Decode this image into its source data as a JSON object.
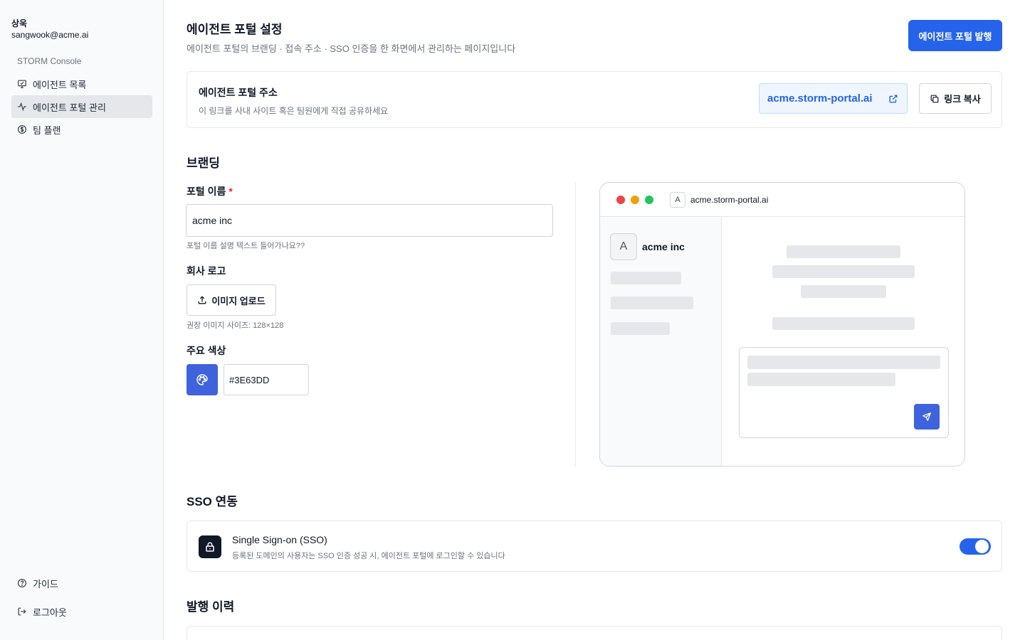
{
  "user": {
    "name": "상욱",
    "email": "sangwook@acme.ai"
  },
  "sidebar": {
    "console_label": "STORM Console",
    "items": [
      {
        "label": "에이전트 목록",
        "icon": "monitor-icon"
      },
      {
        "label": "에이전트 포털 관리",
        "icon": "activity-icon",
        "active": true
      },
      {
        "label": "팀 플랜",
        "icon": "dollar-circle-icon"
      }
    ],
    "bottom": [
      {
        "label": "가이드",
        "icon": "help-circle-icon"
      },
      {
        "label": "로그아웃",
        "icon": "logout-icon"
      }
    ]
  },
  "header": {
    "title": "에이전트 포털 설정",
    "description": "에이전트 포털의 브랜딩 · 접속 주소 · SSO 인증을 한 화면에서 관리하는 페이지입니다",
    "publish_label": "에이전트 포털 발행"
  },
  "address": {
    "title": "에이전트 포털 주소",
    "description": "이 링크를 사내 사이트 혹은 팀원에게 직접 공유하세요",
    "url": "acme.storm-portal.ai",
    "copy_label": "링크 복사"
  },
  "branding": {
    "section_title": "브랜딩",
    "portal_name_label": "포털 이름",
    "required_mark": "*",
    "portal_name_value": "acme inc",
    "portal_name_hint": "포털 이름 설명 텍스트 들어가나요??",
    "logo_label": "회사 로고",
    "upload_label": "이미지 업로드",
    "logo_hint": "권장 이미지 사이즈: 128×128",
    "color_label": "주요 색상",
    "color_value": "#3E63DD"
  },
  "preview": {
    "favicon_letter": "A",
    "url": "acme.storm-portal.ai",
    "avatar_letter": "A",
    "name": "acme inc",
    "dot_colors": [
      "#ef4444",
      "#f59e0b",
      "#22c55e"
    ]
  },
  "sso": {
    "section_title": "SSO 연동",
    "title": "Single Sign-on (SSO)",
    "description": "등록된 도메인의 사용자는 SSO 인증 성공 시, 에이전트 포털에 로그인할 수 있습니다",
    "enabled": true
  },
  "history": {
    "section_title": "발행 이력"
  },
  "colors": {
    "primary": "#2563eb",
    "brand": "#3E63DD",
    "accent_bg": "#eff6ff"
  }
}
